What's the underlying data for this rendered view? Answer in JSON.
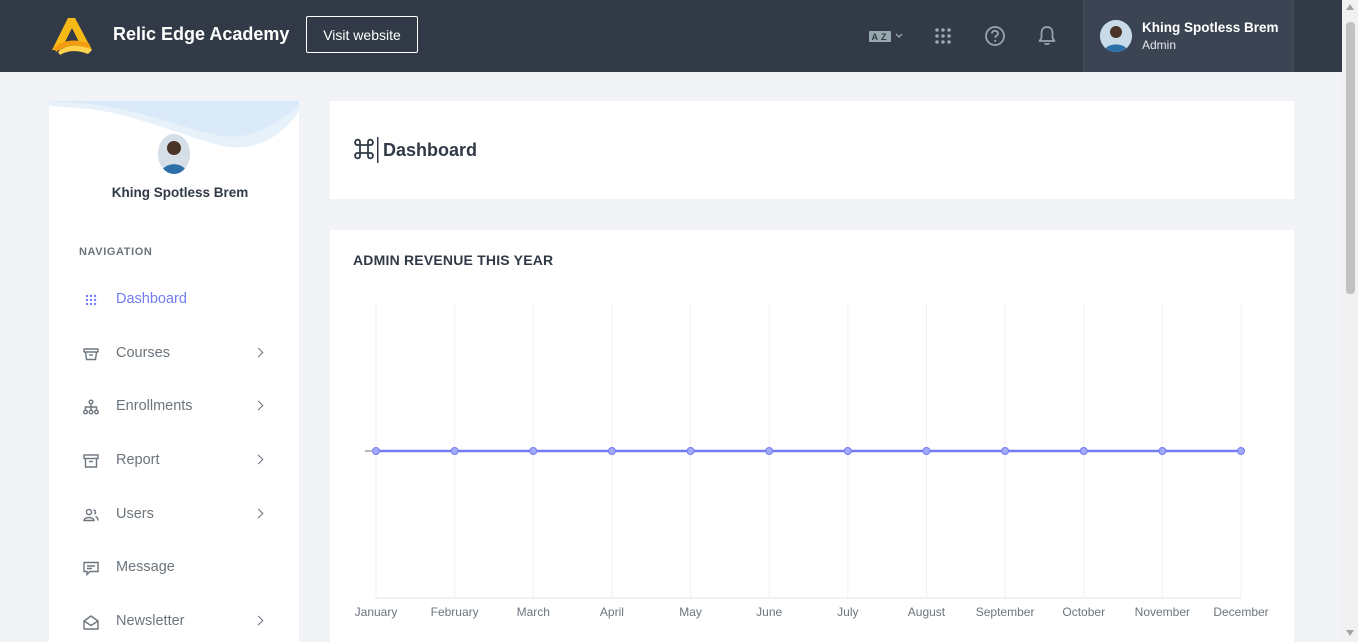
{
  "header": {
    "brand": "Relic Edge Academy",
    "visit_label": "Visit website",
    "icons": [
      "translate-icon",
      "apps-grid-icon",
      "help-icon",
      "bell-icon"
    ],
    "user": {
      "name": "Khing Spotless Brem",
      "role": "Admin"
    }
  },
  "sidebar": {
    "user_name": "Khing Spotless Brem",
    "nav_title": "NAVIGATION",
    "items": [
      {
        "label": "Dashboard",
        "icon": "grid-dots-icon",
        "active": true,
        "has_submenu": false
      },
      {
        "label": "Courses",
        "icon": "courses-icon",
        "active": false,
        "has_submenu": true
      },
      {
        "label": "Enrollments",
        "icon": "hierarchy-icon",
        "active": false,
        "has_submenu": true
      },
      {
        "label": "Report",
        "icon": "archive-icon",
        "active": false,
        "has_submenu": true
      },
      {
        "label": "Users",
        "icon": "users-icon",
        "active": false,
        "has_submenu": true
      },
      {
        "label": "Message",
        "icon": "message-icon",
        "active": false,
        "has_submenu": false
      },
      {
        "label": "Newsletter",
        "icon": "envelope-open-icon",
        "active": false,
        "has_submenu": true
      }
    ]
  },
  "main": {
    "page_title": "Dashboard",
    "revenue_title": "ADMIN REVENUE THIS YEAR"
  },
  "colors": {
    "topbar": "#313a46",
    "accent": "#727cf5",
    "text_muted": "#6c757d"
  },
  "chart_data": {
    "type": "line",
    "title": "ADMIN REVENUE THIS YEAR",
    "categories": [
      "January",
      "February",
      "March",
      "April",
      "May",
      "June",
      "July",
      "August",
      "September",
      "October",
      "November",
      "December"
    ],
    "series": [
      {
        "values": [
          0,
          0,
          0,
          0,
          0,
          0,
          0,
          0,
          0,
          0,
          0,
          0
        ]
      }
    ],
    "xlabel": "",
    "ylabel": "",
    "grid": "vertical",
    "legend": "none"
  }
}
